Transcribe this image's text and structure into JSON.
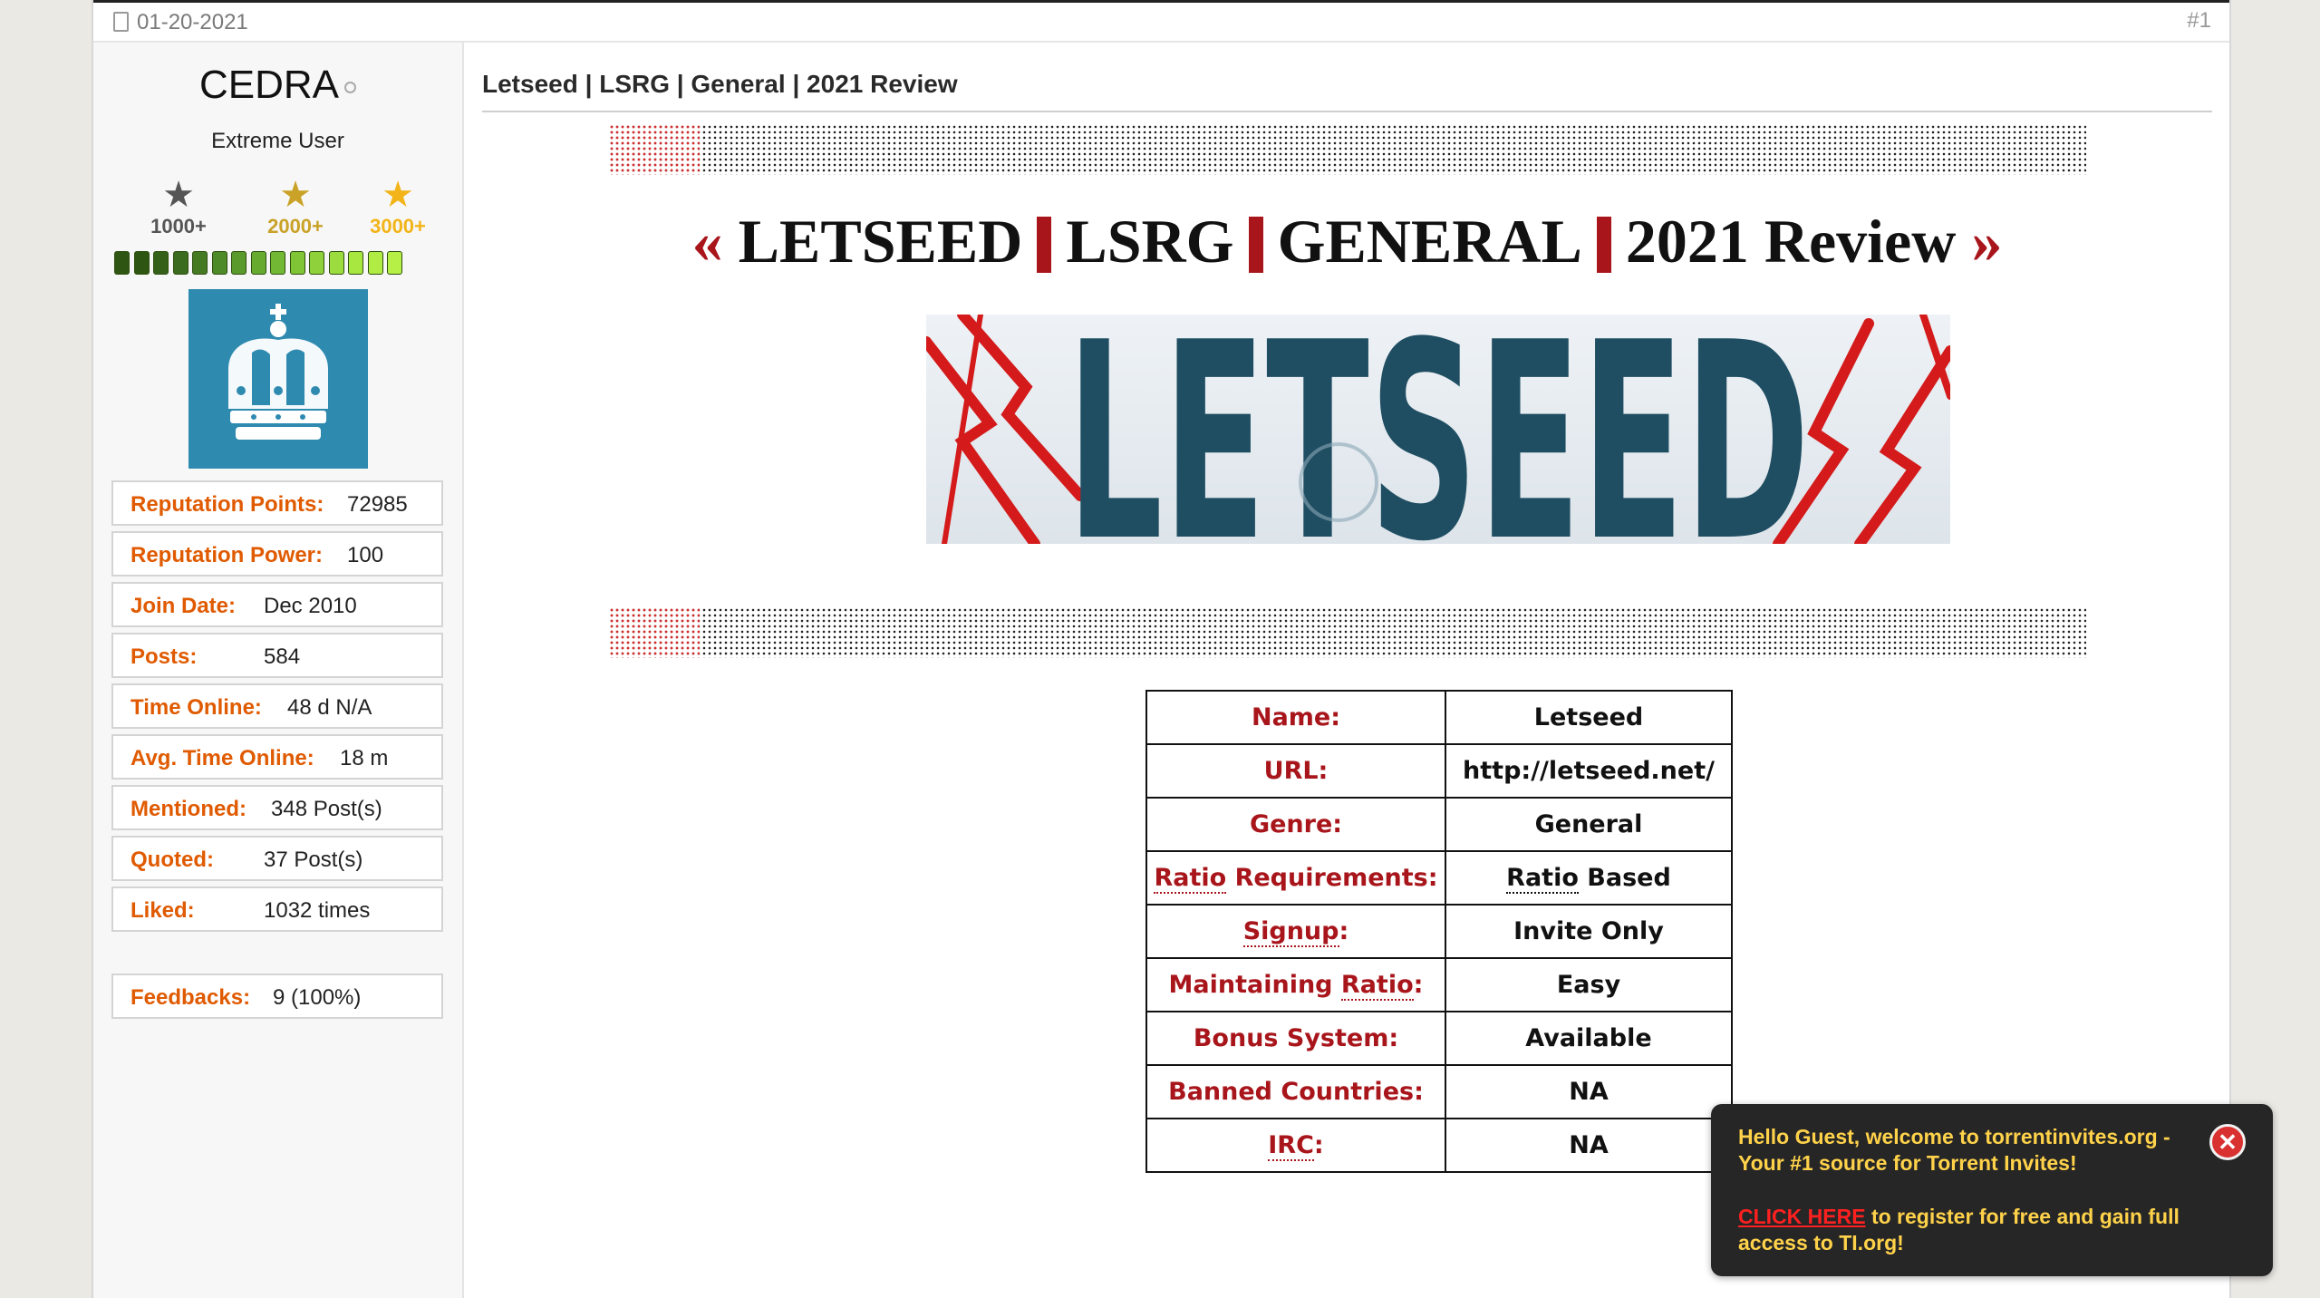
{
  "post": {
    "date": "01-20-2021",
    "number": "#1"
  },
  "user": {
    "name": "CEDRA",
    "title": "Extreme User",
    "ranks": [
      {
        "label": "1000+",
        "color": "#555555"
      },
      {
        "label": "2000+",
        "color": "#c9a227"
      },
      {
        "label": "3000+",
        "color": "#f2b418"
      }
    ],
    "rep_bar": {
      "filled_segments": 15,
      "total_segments": 15
    },
    "stats": [
      {
        "label": "Reputation Points:",
        "value": "72985"
      },
      {
        "label": "Reputation Power:",
        "value": "100"
      },
      {
        "label": "Join Date:",
        "value": "Dec 2010"
      },
      {
        "label": "Posts:",
        "value": "584"
      },
      {
        "label": "Time Online:",
        "value": "48 d N/A"
      },
      {
        "label": "Avg. Time Online:",
        "value": "18 m"
      },
      {
        "label": "Mentioned:",
        "value": "348 Post(s)"
      },
      {
        "label": "Quoted:",
        "value": "37 Post(s)"
      },
      {
        "label": "Liked:",
        "value": "1032 times"
      }
    ],
    "feedbacks": {
      "label": "Feedbacks:",
      "value": "9 (100%)"
    }
  },
  "content": {
    "thread_title": "Letseed | LSRG | General | 2021 Review",
    "headline": {
      "open": "«",
      "parts": [
        "LETSEED",
        "LSRG",
        "GENERAL",
        "2021 Review"
      ],
      "close": "»"
    },
    "banner_text": "LETSEED",
    "table": [
      {
        "key": "Name:",
        "value": "Letseed"
      },
      {
        "key": "URL:",
        "value": "http://letseed.net/"
      },
      {
        "key": "Genre:",
        "value": "General"
      },
      {
        "key_a": "Ratio",
        "key_b": " Requirements:",
        "value_a": "Ratio",
        "value_b": " Based"
      },
      {
        "key_a": "Signup",
        "key_b": ":",
        "value": "Invite Only"
      },
      {
        "key_a": "Maintaining ",
        "key_b": "Ratio",
        "key_c": ":",
        "value": "Easy"
      },
      {
        "key": "Bonus System:",
        "value": "Available"
      },
      {
        "key": "Banned Countries:",
        "value": "NA"
      },
      {
        "key_a": "IRC",
        "key_b": ":",
        "value": "NA"
      }
    ]
  },
  "popup": {
    "welcome": "Hello Guest, welcome to torrentinvites.org - Your #1 source for Torrent Invites!",
    "link": "CLICK HERE",
    "rest": " to register for free and gain full access to TI.org!"
  },
  "colors": {
    "accent_red": "#a8151b",
    "stat_label_orange": "#e05a00",
    "popup_text": "#ffd24a"
  }
}
